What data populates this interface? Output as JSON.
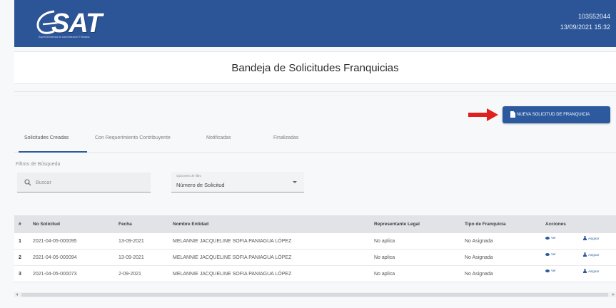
{
  "header": {
    "logo_text": "SAT",
    "logo_subtitle": "Superintendencia de Administración Tributaria",
    "user_id": "103552044",
    "datetime": "13/09/2021 15:32"
  },
  "page": {
    "title": "Bandeja de Solicitudes Franquicias"
  },
  "actions": {
    "new_request_label": "NUEVA SOLICITUD DE FRANQUICIA"
  },
  "tabs": [
    {
      "label": "Solicitudes Creadas"
    },
    {
      "label": "Con Requerimiento Contribuyente"
    },
    {
      "label": "Notificadas"
    },
    {
      "label": "Finalizadas"
    }
  ],
  "filters": {
    "label": "Filtros de Búsqueda",
    "search_placeholder": "Buscar",
    "select_label": "Opciones de filtro",
    "select_value": "Número de Solicitud"
  },
  "table": {
    "headers": {
      "index": "#",
      "request_no": "No Solicitud",
      "date": "Fecha",
      "entity": "Nombre Entidad",
      "legal_rep": "Representante Legal",
      "type": "Tipo de Franquicia",
      "actions": "Acciones"
    },
    "view_label": "Ver",
    "assign_label": "Asignar",
    "rows": [
      {
        "index": "1",
        "request_no": "2021-04-05-000095",
        "date": "13-09-2021",
        "entity": "MELANNIE JACQUELINE SOFIA PANIAGUA LÓPEZ",
        "legal_rep": "No aplica",
        "type": "No Asignada"
      },
      {
        "index": "2",
        "request_no": "2021-04-05-000094",
        "date": "13-09-2021",
        "entity": "MELANNIE JACQUELINE SOFIA PANIAGUA LÓPEZ",
        "legal_rep": "No aplica",
        "type": "No Asignada"
      },
      {
        "index": "3",
        "request_no": "2021-04-05-000073",
        "date": "2-09-2021",
        "entity": "MELANNIE JACQUELINE SOFIA PANIAGUA LÓPEZ",
        "legal_rep": "No aplica",
        "type": "No Asignada"
      }
    ]
  },
  "colors": {
    "primary": "#2d5a9e",
    "header_bg": "#2c5597",
    "arrow": "#e02020"
  }
}
